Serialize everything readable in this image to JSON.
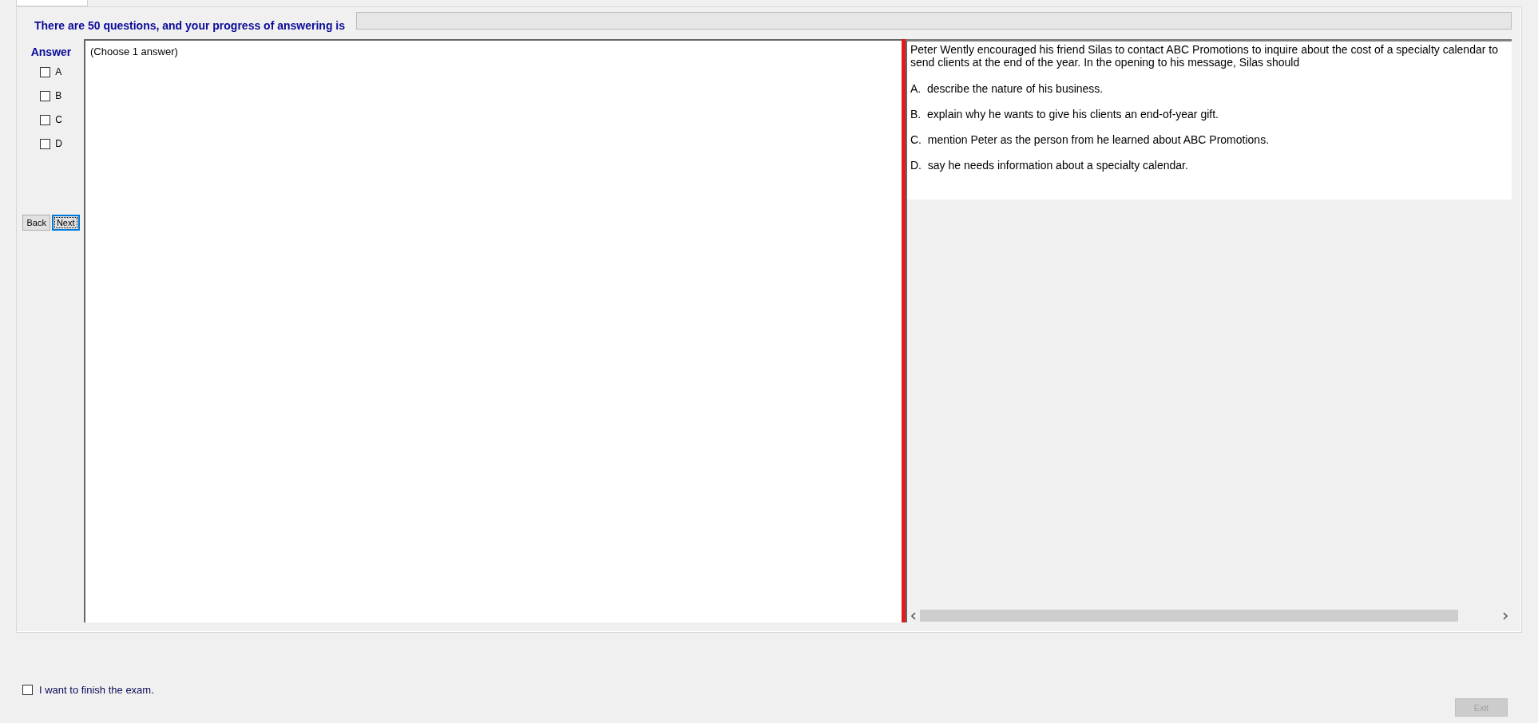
{
  "header": {
    "text": "There are 50 questions, and your progress of answering is",
    "progress": {
      "level": 0
    }
  },
  "answer_panel": {
    "title": "Answer",
    "options": [
      {
        "label": "A",
        "checked": false
      },
      {
        "label": "B",
        "checked": false
      },
      {
        "label": "C",
        "checked": false
      },
      {
        "label": "D",
        "checked": false
      }
    ],
    "buttons": [
      {
        "label": "Back",
        "focused": false
      },
      {
        "label": "Next",
        "focused": true
      }
    ]
  },
  "instruction": "(Choose 1 answer)",
  "question": {
    "text": "Peter Wently encouraged his friend Silas to contact ABC Promotions to inquire about the cost of a specialty calendar to send clients at the end of the year. In the opening to his message, Silas should",
    "choices": [
      "A.  describe the nature of his business.",
      "B.  explain why he wants to give his clients an end-of-year gift.",
      "C.  mention Peter as the person from he learned about ABC Promotions.",
      "D.  say he needs information about a specialty calendar."
    ]
  },
  "finish": {
    "label": "I want to finish the exam.",
    "checked": false
  },
  "exit_button": {
    "label": "Exit",
    "disabled": true
  }
}
